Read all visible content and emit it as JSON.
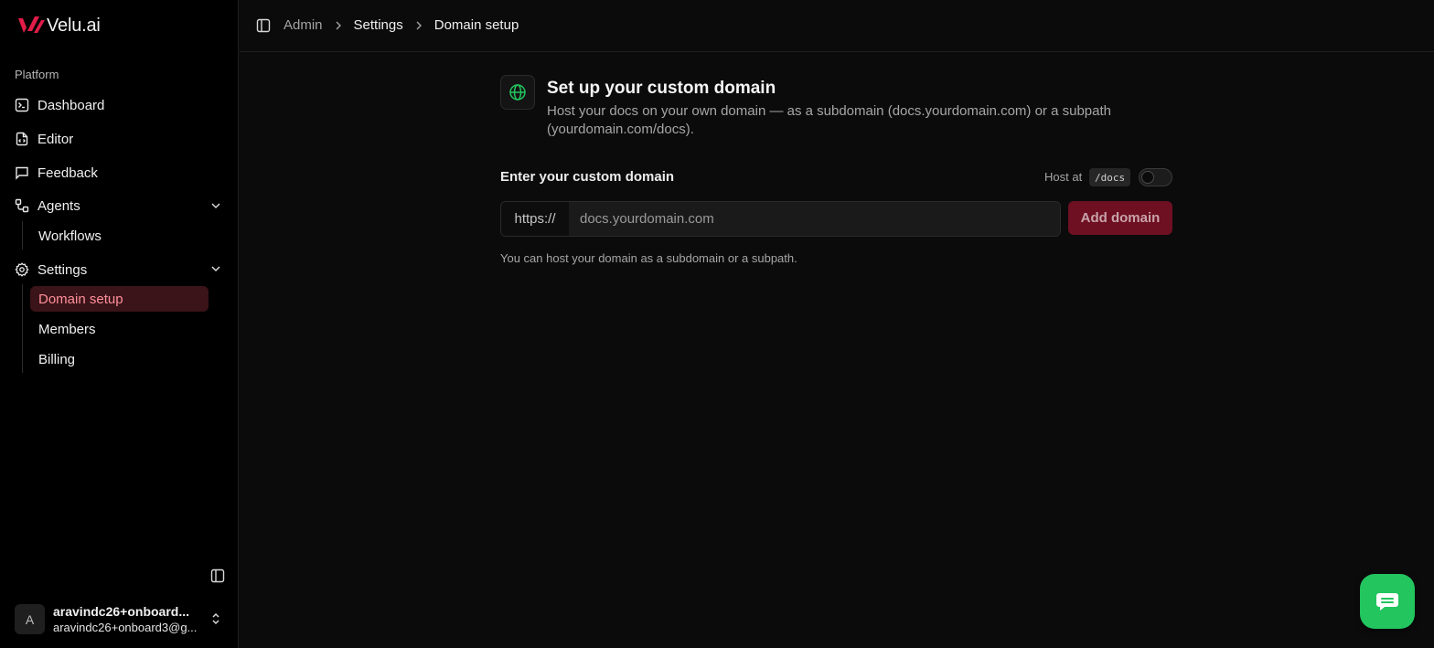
{
  "brand": {
    "name": "Velu.ai"
  },
  "sidebar": {
    "section": "Platform",
    "items": [
      {
        "label": "Dashboard",
        "icon": "terminal-icon"
      },
      {
        "label": "Editor",
        "icon": "file-code-icon"
      },
      {
        "label": "Feedback",
        "icon": "message-square-icon"
      },
      {
        "label": "Agents",
        "icon": "workflow-icon",
        "expanded": true,
        "children": [
          "Workflows"
        ]
      },
      {
        "label": "Settings",
        "icon": "gear-icon",
        "expanded": true,
        "children": [
          "Domain setup",
          "Members",
          "Billing"
        ]
      }
    ],
    "active": "Domain setup",
    "user": {
      "initial": "A",
      "name": "aravindc26+onboard...",
      "email": "aravindc26+onboard3@g..."
    }
  },
  "breadcrumb": {
    "items": [
      "Admin",
      "Settings",
      "Domain setup"
    ]
  },
  "main": {
    "title": "Set up your custom domain",
    "description": "Host your docs on your own domain — as a subdomain (docs.yourdomain.com) or a subpath (yourdomain.com/docs).",
    "field_label": "Enter your custom domain",
    "host_at_label": "Host at",
    "host_at_path": "/docs",
    "host_at_enabled": false,
    "prefix": "https://",
    "input_placeholder": "docs.yourdomain.com",
    "input_value": "",
    "add_button": "Add domain",
    "helper": "You can host your domain as a subdomain or a subpath."
  },
  "colors": {
    "accent": "#6e0f22",
    "active_bg": "#3a1418",
    "active_text": "#ff8f9a",
    "globe": "#22c55e",
    "chat": "#22c55e",
    "logo": "#e11d48"
  }
}
